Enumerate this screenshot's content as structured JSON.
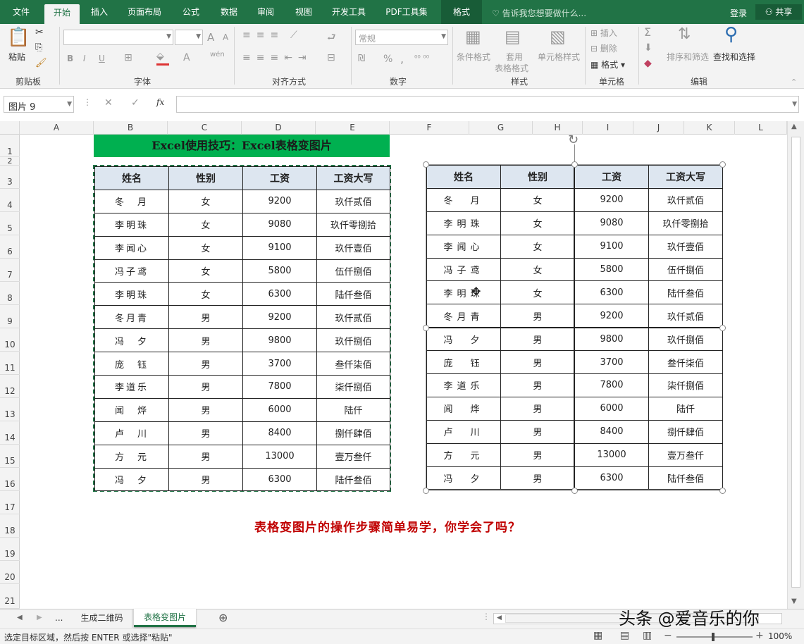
{
  "tabs": [
    "文件",
    "开始",
    "插入",
    "页面布局",
    "公式",
    "数据",
    "审阅",
    "视图",
    "开发工具",
    "PDF工具集",
    "格式"
  ],
  "tell_me": "告诉我您想要做什么...",
  "login": "登录",
  "share": "共享",
  "ribbon": {
    "paste": "粘贴",
    "clipboard": "剪贴板",
    "font": "字体",
    "alignment": "对齐方式",
    "number": "数字",
    "number_format": "常规",
    "styles": "样式",
    "cond_format": "条件格式",
    "table_format_1": "套用",
    "table_format_2": "表格格式",
    "cell_styles": "单元格样式",
    "cells": "单元格",
    "insert": "插入",
    "delete": "删除",
    "format": "格式",
    "editing": "编辑",
    "sort_filter": "排序和筛选",
    "find_select": "查找和选择",
    "bold": "B",
    "italic": "I",
    "underline": "U",
    "font_grow": "A",
    "font_shrink": "A",
    "font_color": "A",
    "percent": "%",
    "comma": ",",
    "sum": "Σ",
    "wen": "wén"
  },
  "name_box": "图片 9",
  "fx": "fx",
  "columns": [
    "A",
    "B",
    "C",
    "D",
    "E",
    "F",
    "G",
    "H",
    "I",
    "J",
    "K",
    "L"
  ],
  "rows": [
    "1",
    "2",
    "3",
    "4",
    "5",
    "6",
    "7",
    "8",
    "9",
    "10",
    "11",
    "12",
    "13",
    "14",
    "15",
    "16",
    "17",
    "18",
    "19",
    "20",
    "21"
  ],
  "title": "Excel使用技巧：Excel表格变图片",
  "table": {
    "headers": [
      "姓名",
      "性别",
      "工资",
      "工资大写"
    ],
    "rows": [
      [
        "冬　月",
        "女",
        "9200",
        "玖仟贰佰"
      ],
      [
        "李明珠",
        "女",
        "9080",
        "玖仟零捌拾"
      ],
      [
        "李闻心",
        "女",
        "9100",
        "玖仟壹佰"
      ],
      [
        "冯子鸢",
        "女",
        "5800",
        "伍仟捌佰"
      ],
      [
        "李明珠",
        "女",
        "6300",
        "陆仟叁佰"
      ],
      [
        "冬月青",
        "男",
        "9200",
        "玖仟贰佰"
      ],
      [
        "冯　夕",
        "男",
        "9800",
        "玖仟捌佰"
      ],
      [
        "庞　钰",
        "男",
        "3700",
        "叁仟柒佰"
      ],
      [
        "李道乐",
        "男",
        "7800",
        "柒仟捌佰"
      ],
      [
        "闻　烨",
        "男",
        "6000",
        "陆仟"
      ],
      [
        "卢　川",
        "男",
        "8400",
        "捌仟肆佰"
      ],
      [
        "方　元",
        "男",
        "13000",
        "壹万叁仟"
      ],
      [
        "冯　夕",
        "男",
        "6300",
        "陆仟叁佰"
      ]
    ]
  },
  "slogan": "表格变图片的操作步骤简单易学，你学会了吗？",
  "sheet_tabs": [
    "生成二维码",
    "表格变图片"
  ],
  "ellipsis": "...",
  "status_text": "选定目标区域，然后按 ENTER 或选择\"粘贴\"",
  "zoom": "100%",
  "watermark": "头条 @爱音乐的你"
}
